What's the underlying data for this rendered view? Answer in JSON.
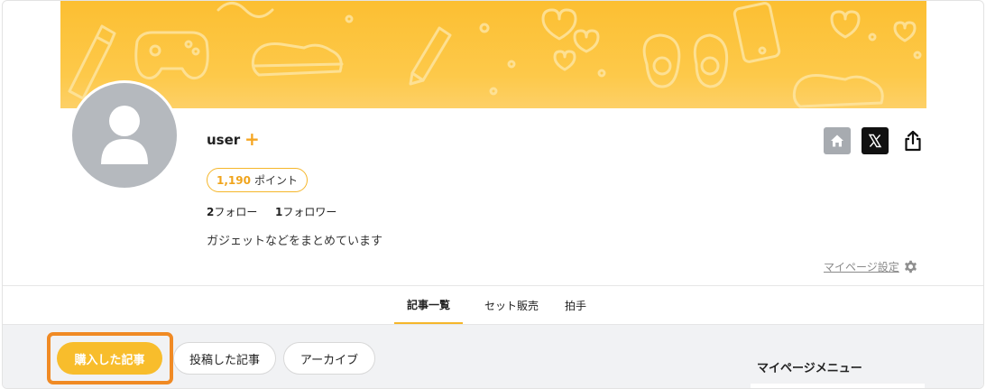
{
  "profile": {
    "username": "user",
    "plus_symbol": "+",
    "points_value": "1,190",
    "points_unit": "ポイント",
    "following_count": "2",
    "following_label": "フォロー",
    "followers_count": "1",
    "followers_label": "フォロワー",
    "bio": "ガジェットなどをまとめています"
  },
  "actions": {
    "home_icon": "home-icon",
    "x_icon": "x-logo-icon",
    "share_icon": "share-icon"
  },
  "settings": {
    "label": "マイページ設定",
    "icon": "gear-icon"
  },
  "tabs": [
    {
      "label": "記事一覧",
      "active": true
    },
    {
      "label": "セット販売",
      "active": false
    },
    {
      "label": "拍手",
      "active": false
    }
  ],
  "filters": [
    {
      "label": "購入した記事",
      "active": true
    },
    {
      "label": "投稿した記事",
      "active": false
    },
    {
      "label": "アーカイブ",
      "active": false
    }
  ],
  "sidebar": {
    "title": "マイページメニュー"
  },
  "colors": {
    "accent": "#f8bd2c",
    "highlight": "#f08a24",
    "cover": "#fcbf32",
    "avatar": "#b5b9be"
  }
}
